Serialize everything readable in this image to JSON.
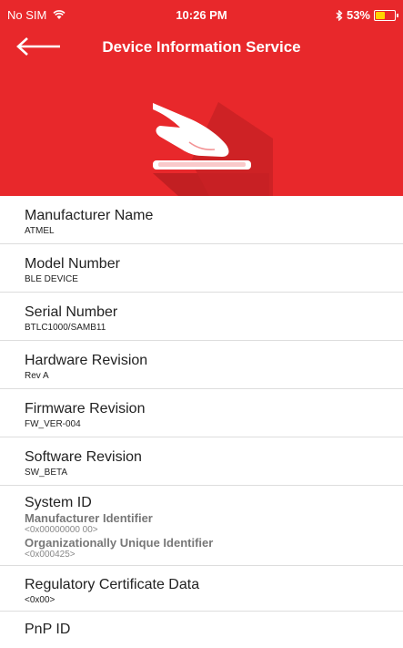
{
  "status": {
    "carrier": "No SIM",
    "time": "10:26 PM",
    "battery": "53%",
    "battery_fraction": 0.53,
    "colors": {
      "bar": "#e8282b",
      "battery_fill": "#ffd400"
    }
  },
  "nav": {
    "title": "Device Information Service",
    "back_icon": "arrow-left-icon"
  },
  "hero": {
    "icon": "hand-touch-phone-icon"
  },
  "items": [
    {
      "title": "Manufacturer Name",
      "value": "ATMEL"
    },
    {
      "title": "Model Number",
      "value": "BLE DEVICE"
    },
    {
      "title": "Serial Number",
      "value": "BTLC1000/SAMB11"
    },
    {
      "title": "Hardware Revision",
      "value": "Rev A"
    },
    {
      "title": "Firmware Revision",
      "value": "FW_VER-004"
    },
    {
      "title": "Software Revision",
      "value": "SW_BETA"
    }
  ],
  "system_id": {
    "title": "System ID",
    "manufacturer_label": "Manufacturer Identifier",
    "manufacturer_value": "<0x00000000 00>",
    "oui_label": "Organizationally Unique Identifier",
    "oui_value": "<0x000425>"
  },
  "regulatory": {
    "title": "Regulatory Certificate Data",
    "value": "<0x00>"
  },
  "pnp": {
    "title": "PnP ID"
  }
}
